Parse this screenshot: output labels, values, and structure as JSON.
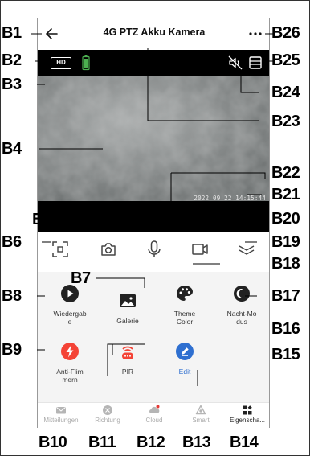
{
  "header": {
    "title": "4G PTZ Akku Kamera"
  },
  "video": {
    "hd_label": "HD",
    "timestamp": "2022 09 22 14:15:44"
  },
  "features": [
    {
      "label": "Wiedergab\ne",
      "icon": "play-icon"
    },
    {
      "label": "Galerie",
      "icon": "gallery-icon"
    },
    {
      "label": "Theme\nColor",
      "icon": "palette-icon"
    },
    {
      "label": "Nacht-Mo\ndus",
      "icon": "moon-icon"
    },
    {
      "label": "Anti-Flim\nmern",
      "icon": "flash-icon"
    },
    {
      "label": "PIR",
      "icon": "pir-icon"
    },
    {
      "label": "Edit",
      "icon": "edit-icon"
    }
  ],
  "nav": [
    {
      "label": "Mitteilungen",
      "icon": "mail-icon"
    },
    {
      "label": "Richtung",
      "icon": "direction-icon"
    },
    {
      "label": "Cloud",
      "icon": "cloud-icon"
    },
    {
      "label": "Smart",
      "icon": "smart-icon"
    },
    {
      "label": "Eigenscha...",
      "icon": "grid-icon"
    }
  ],
  "callouts": {
    "b1": "B1",
    "b2": "B2",
    "b3": "B3",
    "b4": "B4",
    "b5": "B5",
    "b6": "B6",
    "b7": "B7",
    "b8": "B8",
    "b9": "B9",
    "b10": "B10",
    "b11": "B11",
    "b12": "B12",
    "b13": "B13",
    "b14": "B14",
    "b15": "B15",
    "b16": "B16",
    "b17": "B17",
    "b18": "B18",
    "b19": "B19",
    "b20": "B20",
    "b21": "B21",
    "b22": "B22",
    "b23": "B23",
    "b24": "B24",
    "b25": "B25",
    "b26": "B26"
  },
  "colors": {
    "accent_red": "#f44336",
    "accent_blue": "#2e6fd0",
    "battery": "#4caf50"
  }
}
